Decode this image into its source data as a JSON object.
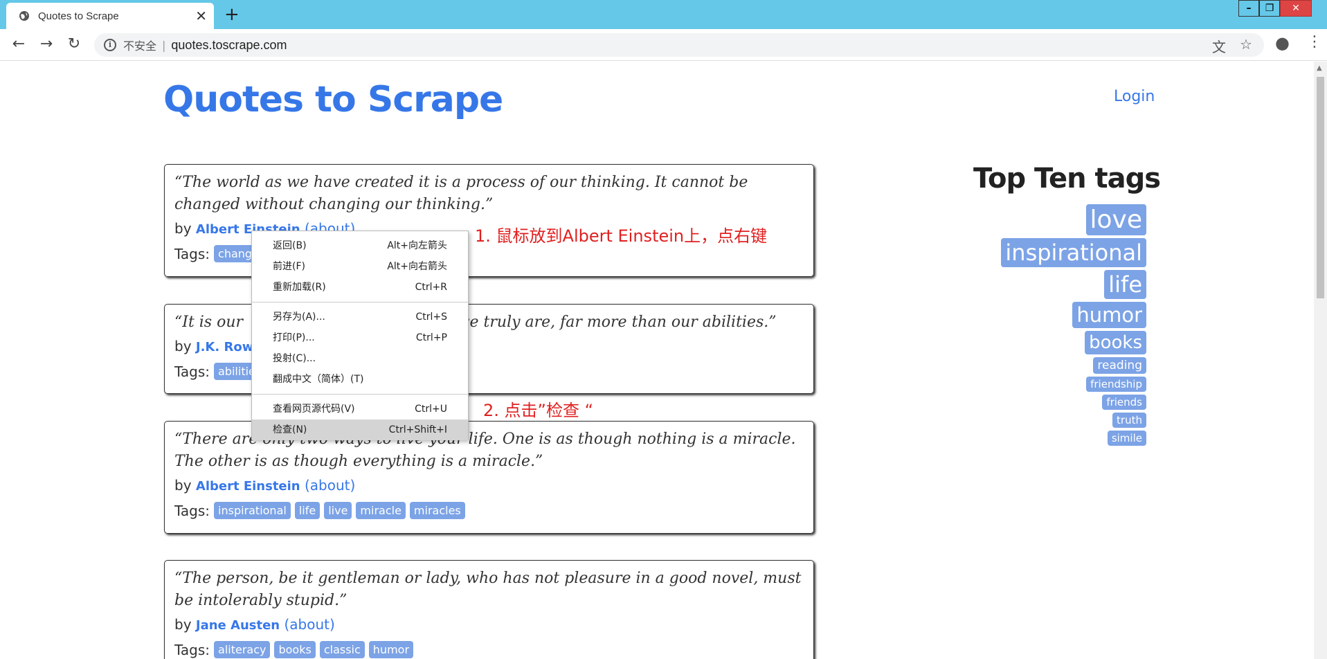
{
  "browser": {
    "tab_title": "Quotes to Scrape",
    "tab_close": "✕",
    "new_tab": "+",
    "insecure_label": "不安全",
    "url": "quotes.toscrape.com"
  },
  "site": {
    "title": "Quotes to Scrape",
    "login": "Login"
  },
  "quotes": [
    {
      "text": "“The world as we have created it is a process of our thinking. It cannot be changed without changing our thinking.”",
      "by": "by",
      "author": "Albert Einstein",
      "about": "(about)",
      "tags_label": "Tags:",
      "tags": [
        "change"
      ]
    },
    {
      "text": "“It is our                                        at we truly are, far more than our abilities.”",
      "by": "by",
      "author": "J.K. Rowli",
      "tags_label": "Tags:",
      "tags": [
        "abilitie"
      ]
    },
    {
      "text": "“There are only two ways to live your life. One is as though nothing is a miracle. The other is as though everything is a miracle.”",
      "by": "by",
      "author": "Albert Einstein",
      "about": "(about)",
      "tags_label": "Tags:",
      "tags": [
        "inspirational",
        "life",
        "live",
        "miracle",
        "miracles"
      ]
    },
    {
      "text": "“The person, be it gentleman or lady, who has not pleasure in a good novel, must be intolerably stupid.”",
      "by": "by",
      "author": "Jane Austen",
      "about": "(about)",
      "tags_label": "Tags:",
      "tags": [
        "aliteracy",
        "books",
        "classic",
        "humor"
      ]
    }
  ],
  "sidebar": {
    "title": "Top Ten tags",
    "tags": [
      "love",
      "inspirational",
      "life",
      "humor",
      "books",
      "reading",
      "friendship",
      "friends",
      "truth",
      "simile"
    ]
  },
  "context_menu": {
    "items": [
      {
        "label": "返回(B)",
        "shortcut": "Alt+向左箭头"
      },
      {
        "label": "前进(F)",
        "shortcut": "Alt+向右箭头"
      },
      {
        "label": "重新加载(R)",
        "shortcut": "Ctrl+R"
      },
      {
        "label": "另存为(A)...",
        "shortcut": "Ctrl+S"
      },
      {
        "label": "打印(P)...",
        "shortcut": "Ctrl+P"
      },
      {
        "label": "投射(C)...",
        "shortcut": ""
      },
      {
        "label": "翻成中文（简体）(T)",
        "shortcut": ""
      },
      {
        "label": "查看网页源代码(V)",
        "shortcut": "Ctrl+U"
      },
      {
        "label": "检查(N)",
        "shortcut": "Ctrl+Shift+I"
      }
    ]
  },
  "annotations": {
    "step1": "1. 鼠标放到Albert Einstein上，点右键",
    "step2": "2. 点击”检查 “"
  },
  "colors": {
    "titlebar": "#65c8e8",
    "link": "#3677e8",
    "tag_bg": "#7ca3e6",
    "annotation": "#e02020"
  }
}
